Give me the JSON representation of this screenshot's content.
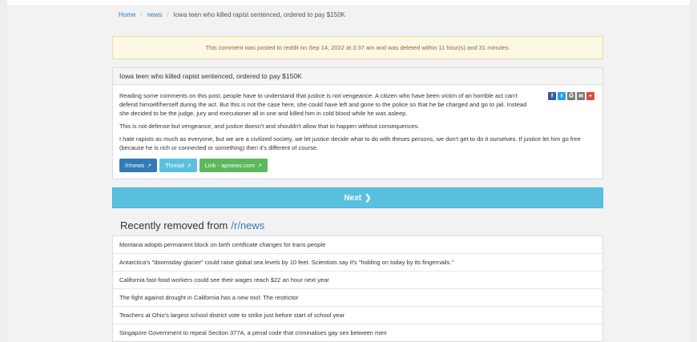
{
  "breadcrumb": {
    "home": "Home",
    "news": "news",
    "current": "Iowa teen who killed rapist sentenced, ordered to pay $150K"
  },
  "alert": {
    "text": "This comment was posted to reddit on Sep 14, 2022 at 3:37 am and was deleted within 11 hour(s) and 31 minutes."
  },
  "post": {
    "title": "Iowa teen who killed rapist sentenced, ordered to pay $150K",
    "paragraphs": [
      "Reading some comments on this post, people have to understand that justice is not vengeance. A citizen who have been victim of an horrible act can't defend himself/herself during the act. But this is not the case here, she could have left and gone to the police so that he be charged and go to jail. Instead she decided to be the judge, jury and executioner all in one and killed him in cold blood while he was asleep.",
      "This is not defense but vengeance, and justice doesn't and shouldn't allow that to happen without consequences.",
      "I hate rapists as much as everyone, but we are a civilized society, we let justice decide what to do with theses persons, we don't get to do it ourselves. If justice let him go free (because he is rich or connected or something) then it's different of course."
    ],
    "buttons": {
      "subreddit": "/r/news",
      "thread": "Thread",
      "link": "Link - apnews.com"
    },
    "share_icons": [
      "facebook-icon",
      "twitter-icon",
      "print-icon",
      "email-icon",
      "plus-icon"
    ],
    "share_colors": [
      "#3b5998",
      "#1da1f2",
      "#777777",
      "#777777",
      "#dd4b39"
    ]
  },
  "next": {
    "label": "Next"
  },
  "recent": {
    "title_prefix": "Recently removed from",
    "title_link": "/r/news",
    "items": [
      "Montana adopts permanent block on birth certificate changes for trans people",
      "Antarctica's \"doomsday glacier\" could raise global sea levels by 10 feet. Scientists say it's \"holding on today by its fingernails.\"",
      "California fast-food workers could see their wages reach $22 an hour next year",
      "The fight against drought in California has a new tool: The restrictor",
      "Teachers at Ohio's largest school district vote to strike just before start of school year",
      "Singapore Government to repeal Section 377A, a penal code that criminalises gay sex between men"
    ]
  }
}
